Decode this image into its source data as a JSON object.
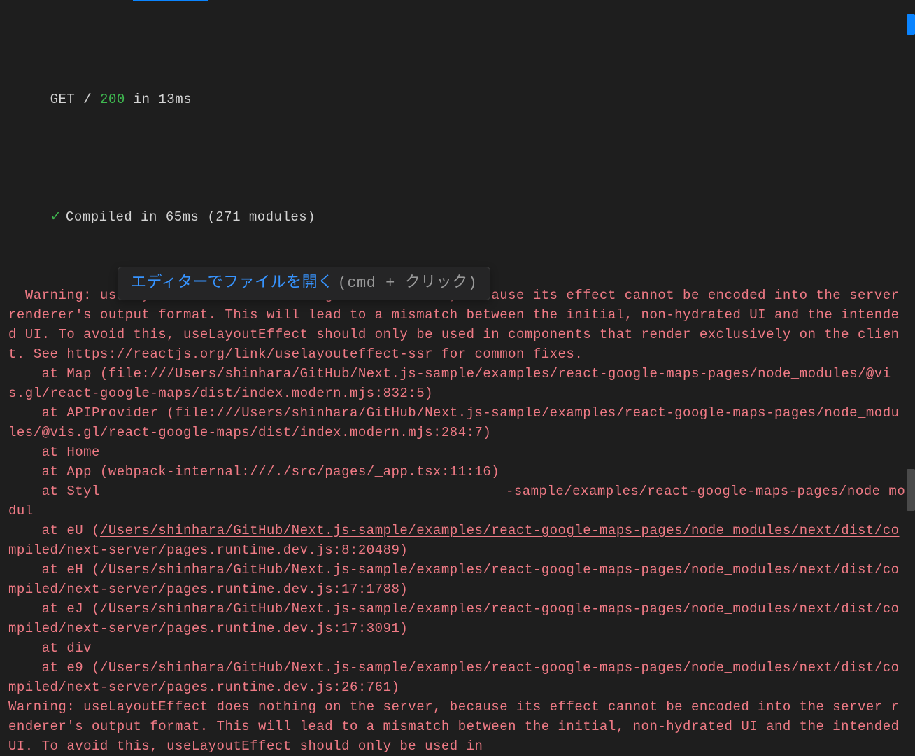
{
  "tab_indicator": true,
  "request": {
    "method": "GET",
    "path": "/",
    "status": "200",
    "in": "in",
    "time": "13ms"
  },
  "compiled": {
    "check": "✓",
    "text": "Compiled in 65ms (271 modules)"
  },
  "warning1": "Warning: useLayoutEffect does nothing on the server, because its effect cannot be encoded into the server renderer's output format. This will lead to a mismatch between the initial, non-hydrated UI and the intended UI. To avoid this, useLayoutEffect should only be used in components that render exclusively on the client. See https://reactjs.org/link/uselayouteffect-ssr for common fixes.",
  "stack": {
    "l1": "    at Map (file:///Users/shinhara/GitHub/Next.js-sample/examples/react-google-maps-pages/node_modules/@vis.gl/react-google-maps/dist/index.modern.mjs:832:5)",
    "l2": "    at APIProvider (file:///Users/shinhara/GitHub/Next.js-sample/examples/react-google-maps-pages/node_modules/@vis.gl/react-google-maps/dist/index.modern.mjs:284:7)",
    "l3": "    at Home",
    "l4": "    at App (webpack-internal:///./src/pages/_app.tsx:11:16)",
    "l5a": "    at Styl",
    "l5b": "-sample/examples/react-google-maps-pages/node_modul",
    "l6pre": "    at eU (",
    "l6link": "/Users/shinhara/GitHub/Next.js-sample/examples/react-google-maps-pages/node_modules/next/dist/compiled/next-server/pages.runtime.dev.js:8:20489",
    "l6post": ")",
    "l7": "    at eH (/Users/shinhara/GitHub/Next.js-sample/examples/react-google-maps-pages/node_modules/next/dist/compiled/next-server/pages.runtime.dev.js:17:1788)",
    "l8": "    at eJ (/Users/shinhara/GitHub/Next.js-sample/examples/react-google-maps-pages/node_modules/next/dist/compiled/next-server/pages.runtime.dev.js:17:3091)",
    "l9": "    at div",
    "l10": "    at e9 (/Users/shinhara/GitHub/Next.js-sample/examples/react-google-maps-pages/node_modules/next/dist/compiled/next-server/pages.runtime.dev.js:26:761)"
  },
  "warning2": "Warning: useLayoutEffect does nothing on the server, because its effect cannot be encoded into the server renderer's output format. This will lead to a mismatch between the initial, non-hydrated UI and the intended UI. To avoid this, useLayoutEffect should only be used in",
  "tooltip": {
    "primary": "エディターでファイルを開く",
    "secondary": "(cmd + クリック)"
  }
}
